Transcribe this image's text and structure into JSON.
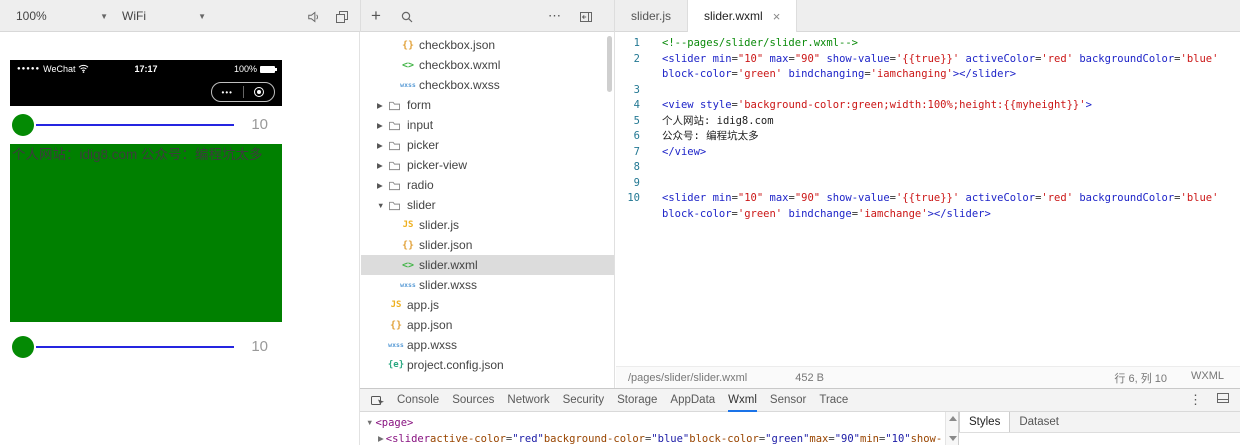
{
  "toolbar": {
    "zoom_label": "100%",
    "network_label": "WiFi",
    "add_label": "+",
    "more_label": "⋯",
    "editor_tabs": [
      {
        "label": "slider.js",
        "active": false
      },
      {
        "label": "slider.wxml",
        "active": true,
        "close_label": "×"
      }
    ]
  },
  "simulator": {
    "signal_dots": "●●●●●",
    "carrier": "WeChat",
    "time": "17:17",
    "battery": "100%",
    "capsule_more": "•••",
    "sliders": [
      {
        "value": "10"
      },
      {
        "value": "10"
      }
    ],
    "view_text": "个人网站：idig8.com 公众号：编程坑太多",
    "colors": {
      "view_bg": "#008000",
      "thumb": "#048a04",
      "track": "#2525e0"
    }
  },
  "filetree": {
    "items": [
      {
        "type": "file",
        "kind": "json",
        "label": "checkbox.json",
        "indent": 2
      },
      {
        "type": "file",
        "kind": "wxml",
        "label": "checkbox.wxml",
        "indent": 2
      },
      {
        "type": "file",
        "kind": "wxss",
        "label": "checkbox.wxss",
        "indent": 2
      },
      {
        "type": "folder",
        "label": "form",
        "expanded": false
      },
      {
        "type": "folder",
        "label": "input",
        "expanded": false
      },
      {
        "type": "folder",
        "label": "picker",
        "expanded": false
      },
      {
        "type": "folder",
        "label": "picker-view",
        "expanded": false
      },
      {
        "type": "folder",
        "label": "radio",
        "expanded": false
      },
      {
        "type": "folder",
        "label": "slider",
        "expanded": true
      },
      {
        "type": "file",
        "kind": "js",
        "label": "slider.js",
        "indent": 2
      },
      {
        "type": "file",
        "kind": "json",
        "label": "slider.json",
        "indent": 2
      },
      {
        "type": "file",
        "kind": "wxml",
        "label": "slider.wxml",
        "indent": 2,
        "selected": true
      },
      {
        "type": "file",
        "kind": "wxss",
        "label": "slider.wxss",
        "indent": 2
      },
      {
        "type": "file",
        "kind": "js",
        "label": "app.js",
        "indent": 1
      },
      {
        "type": "file",
        "kind": "json",
        "label": "app.json",
        "indent": 1
      },
      {
        "type": "file",
        "kind": "wxss",
        "label": "app.wxss",
        "indent": 1
      },
      {
        "type": "file",
        "kind": "econfig",
        "label": "project.config.json",
        "indent": 1
      }
    ]
  },
  "editor": {
    "lines": [
      {
        "n": 1,
        "tokens": [
          {
            "t": "comment",
            "s": "<!--pages/slider/slider.wxml-->"
          }
        ]
      },
      {
        "n": 2,
        "tokens": [
          {
            "t": "tag",
            "s": "<slider"
          },
          {
            "t": "plain",
            "s": " "
          },
          {
            "t": "attr",
            "s": "min"
          },
          {
            "t": "op",
            "s": "="
          },
          {
            "t": "str",
            "s": "\"10\""
          },
          {
            "t": "plain",
            "s": " "
          },
          {
            "t": "attr",
            "s": "max"
          },
          {
            "t": "op",
            "s": "="
          },
          {
            "t": "str",
            "s": "\"90\""
          },
          {
            "t": "plain",
            "s": " "
          },
          {
            "t": "attr",
            "s": "show-value"
          },
          {
            "t": "op",
            "s": "="
          },
          {
            "t": "str",
            "s": "'{{true}}'"
          },
          {
            "t": "plain",
            "s": " "
          },
          {
            "t": "attr",
            "s": "activeColor"
          },
          {
            "t": "op",
            "s": "="
          },
          {
            "t": "str",
            "s": "'red'"
          },
          {
            "t": "plain",
            "s": " "
          },
          {
            "t": "attr",
            "s": "backgroundColor"
          },
          {
            "t": "op",
            "s": "="
          },
          {
            "t": "str",
            "s": "'blue'"
          },
          {
            "t": "plain",
            "s": " "
          },
          {
            "t": "attr",
            "s": "block-color"
          },
          {
            "t": "op",
            "s": "="
          },
          {
            "t": "str",
            "s": "'green'"
          },
          {
            "t": "plain",
            "s": " "
          },
          {
            "t": "attr",
            "s": "bindchanging"
          },
          {
            "t": "op",
            "s": "="
          },
          {
            "t": "str",
            "s": "'iamchanging'"
          },
          {
            "t": "tag",
            "s": "></slider>"
          }
        ]
      },
      {
        "n": 3,
        "tokens": []
      },
      {
        "n": 4,
        "tokens": [
          {
            "t": "tag",
            "s": "<view"
          },
          {
            "t": "plain",
            "s": " "
          },
          {
            "t": "attr",
            "s": "style"
          },
          {
            "t": "op",
            "s": "="
          },
          {
            "t": "str",
            "s": "'background-color:green;width:100%;height:{{myheight}}'"
          },
          {
            "t": "tag",
            "s": ">"
          }
        ]
      },
      {
        "n": 5,
        "tokens": [
          {
            "t": "plain",
            "s": "个人网站: idig8.com"
          }
        ]
      },
      {
        "n": 6,
        "tokens": [
          {
            "t": "plain",
            "s": "公众号: 编程坑太多"
          }
        ]
      },
      {
        "n": 7,
        "tokens": [
          {
            "t": "tag",
            "s": "</view>"
          }
        ]
      },
      {
        "n": 8,
        "tokens": []
      },
      {
        "n": 9,
        "tokens": []
      },
      {
        "n": 10,
        "tokens": [
          {
            "t": "tag",
            "s": "<slider"
          },
          {
            "t": "plain",
            "s": " "
          },
          {
            "t": "attr",
            "s": "min"
          },
          {
            "t": "op",
            "s": "="
          },
          {
            "t": "str",
            "s": "\"10\""
          },
          {
            "t": "plain",
            "s": " "
          },
          {
            "t": "attr",
            "s": "max"
          },
          {
            "t": "op",
            "s": "="
          },
          {
            "t": "str",
            "s": "\"90\""
          },
          {
            "t": "plain",
            "s": " "
          },
          {
            "t": "attr",
            "s": "show-value"
          },
          {
            "t": "op",
            "s": "="
          },
          {
            "t": "str",
            "s": "'{{true}}'"
          },
          {
            "t": "plain",
            "s": " "
          },
          {
            "t": "attr",
            "s": "activeColor"
          },
          {
            "t": "op",
            "s": "="
          },
          {
            "t": "str",
            "s": "'red'"
          },
          {
            "t": "plain",
            "s": " "
          },
          {
            "t": "attr",
            "s": "backgroundColor"
          },
          {
            "t": "op",
            "s": "="
          },
          {
            "t": "str",
            "s": "'blue'"
          },
          {
            "t": "plain",
            "s": " "
          },
          {
            "t": "attr",
            "s": "block-color"
          },
          {
            "t": "op",
            "s": "="
          },
          {
            "t": "str",
            "s": "'green'"
          },
          {
            "t": "plain",
            "s": " "
          },
          {
            "t": "attr",
            "s": "bindchange"
          },
          {
            "t": "op",
            "s": "="
          },
          {
            "t": "str",
            "s": "'iamchange'"
          },
          {
            "t": "tag",
            "s": "></slider>"
          }
        ]
      }
    ],
    "status": {
      "path": "/pages/slider/slider.wxml",
      "size": "452 B",
      "cursor": "行 6, 列 10",
      "mode": "WXML"
    }
  },
  "devtools": {
    "tabs": [
      "Console",
      "Sources",
      "Network",
      "Security",
      "Storage",
      "AppData",
      "Wxml",
      "Sensor",
      "Trace"
    ],
    "active_tab": "Wxml",
    "menu_label": "⋮",
    "dom_lines": [
      {
        "indent": 0,
        "arrow": "▼",
        "tokens": [
          {
            "t": "tag",
            "s": "<page>"
          }
        ]
      },
      {
        "indent": 1,
        "arrow": "▶",
        "tokens": [
          {
            "t": "tag",
            "s": "<slider"
          },
          {
            "t": "plain",
            "s": " "
          },
          {
            "t": "attrname",
            "s": "active-color"
          },
          {
            "t": "op",
            "s": "="
          },
          {
            "t": "val",
            "s": "\"red\""
          },
          {
            "t": "plain",
            "s": " "
          },
          {
            "t": "attrname",
            "s": "background-color"
          },
          {
            "t": "op",
            "s": "="
          },
          {
            "t": "val",
            "s": "\"blue\""
          },
          {
            "t": "plain",
            "s": " "
          },
          {
            "t": "attrname",
            "s": "block-color"
          },
          {
            "t": "op",
            "s": "="
          },
          {
            "t": "val",
            "s": "\"green\""
          },
          {
            "t": "plain",
            "s": " "
          },
          {
            "t": "attrname",
            "s": "max"
          },
          {
            "t": "op",
            "s": "="
          },
          {
            "t": "val",
            "s": "\"90\""
          },
          {
            "t": "plain",
            "s": " "
          },
          {
            "t": "attrname",
            "s": "min"
          },
          {
            "t": "op",
            "s": "="
          },
          {
            "t": "val",
            "s": "\"10\""
          },
          {
            "t": "plain",
            "s": " "
          },
          {
            "t": "attrname",
            "s": "show-"
          }
        ]
      }
    ],
    "side_tabs": [
      {
        "label": "Styles",
        "active": true
      },
      {
        "label": "Dataset",
        "active": false
      }
    ]
  }
}
